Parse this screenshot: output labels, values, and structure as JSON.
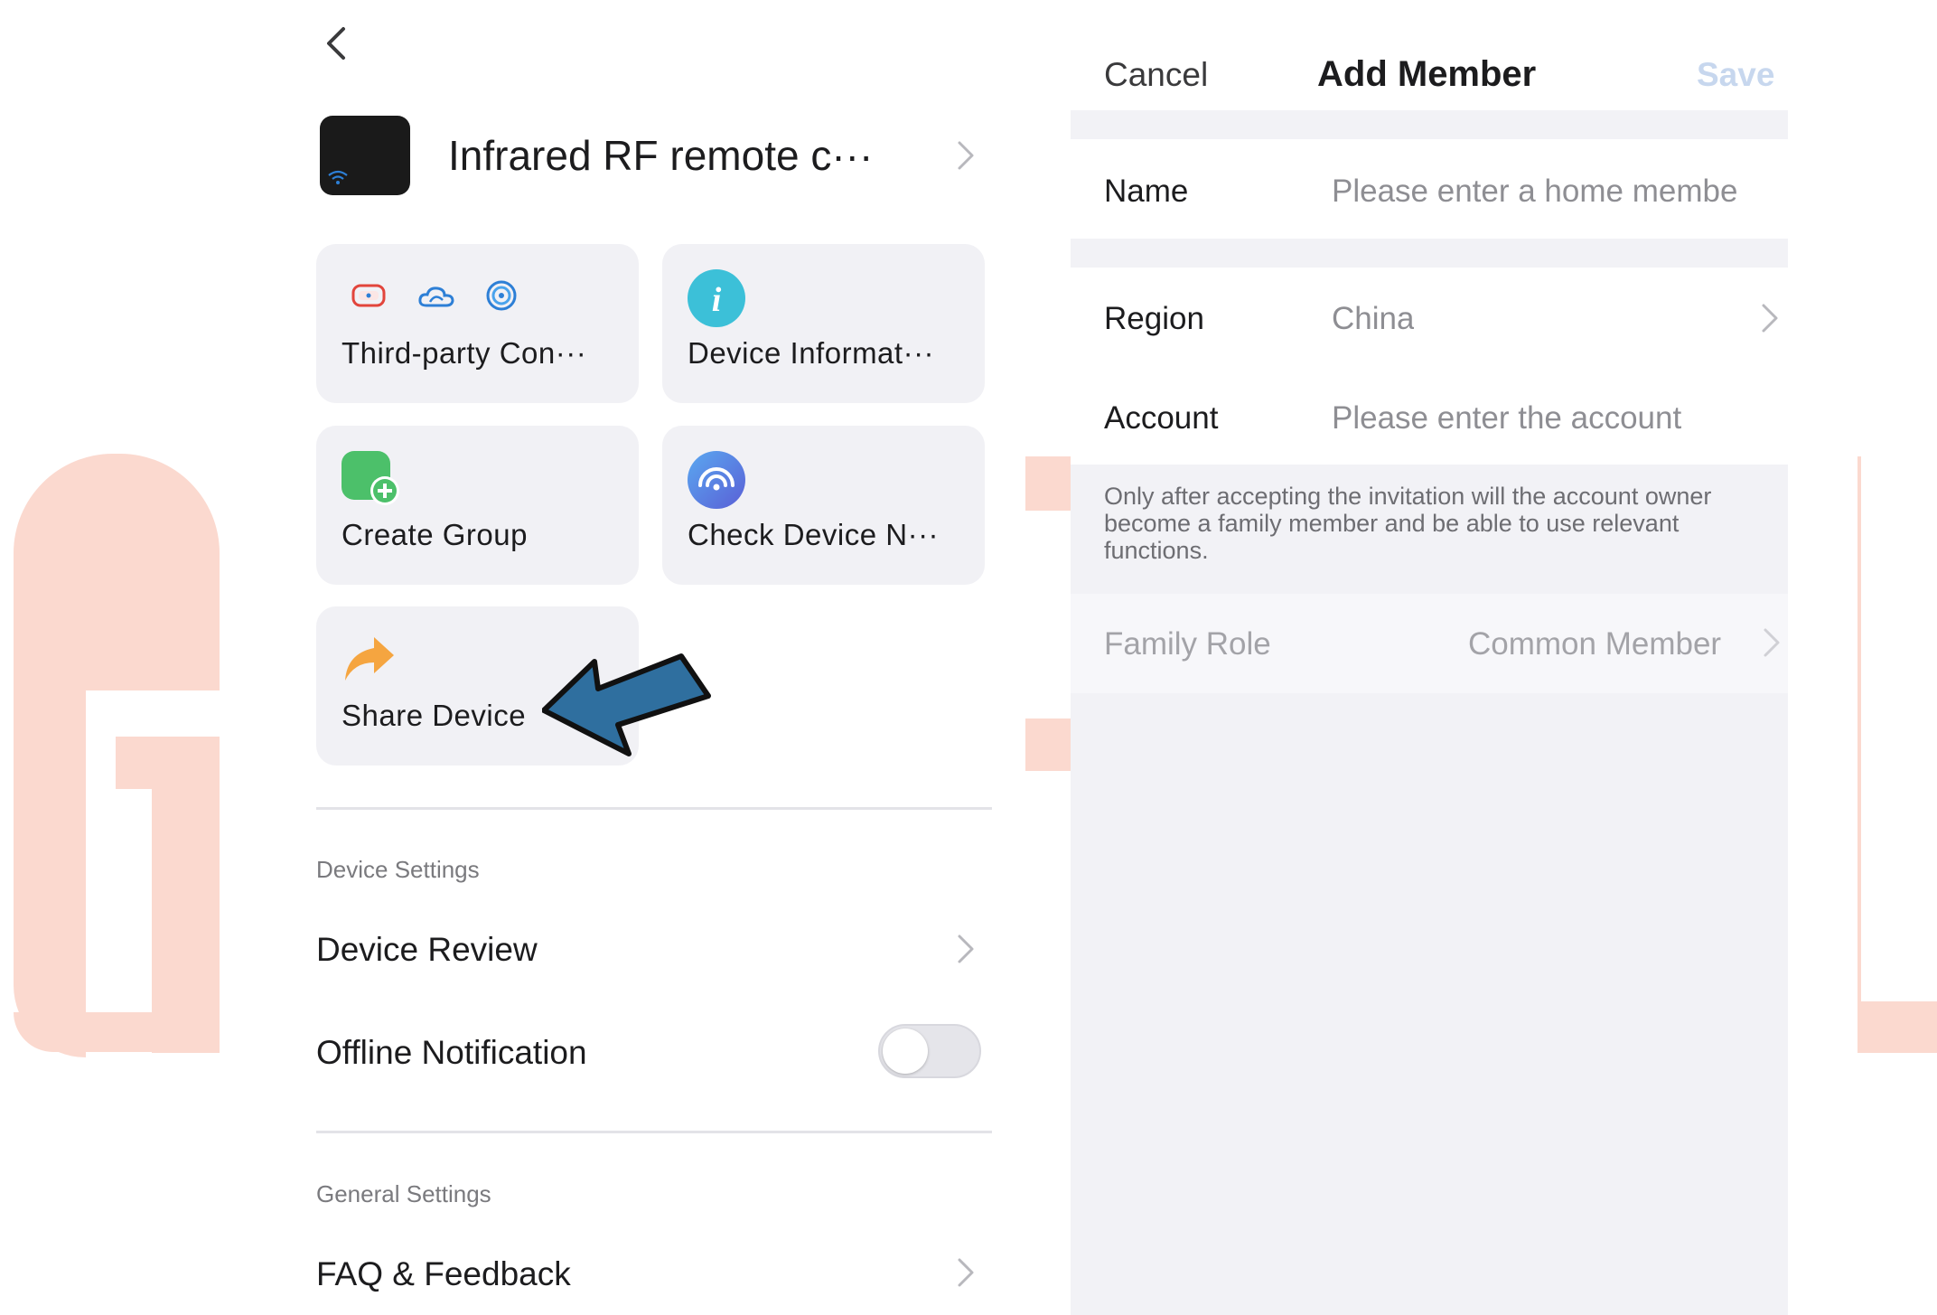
{
  "device": {
    "name": "Infrared RF remote c···"
  },
  "cards": {
    "third_party": "Third-party Con···",
    "device_info": "Device Informat···",
    "create_group": "Create Group",
    "check_network": "Check Device N···",
    "share_device": "Share Device"
  },
  "sections": {
    "device_settings": {
      "title": "Device Settings",
      "device_review": "Device Review",
      "offline_notification": "Offline Notification",
      "offline_notification_on": false
    },
    "general_settings": {
      "title": "General Settings",
      "faq": "FAQ & Feedback"
    }
  },
  "add_member": {
    "cancel": "Cancel",
    "title": "Add Member",
    "save": "Save",
    "name_label": "Name",
    "name_placeholder": "Please enter a home membe",
    "region_label": "Region",
    "region_value": "China",
    "account_label": "Account",
    "account_placeholder": "Please enter the account",
    "note": "Only after accepting the invitation will the account owner become a family member and be able to use relevant functions.",
    "role_label": "Family Role",
    "role_value": "Common Member"
  },
  "colors": {
    "accent_blue": "#4a90e2",
    "save_disabled": "#c7d7ee",
    "card_bg": "#f1f1f5",
    "watermark": "#fbd9cf",
    "share_icon": "#f5a540",
    "group_icon": "#4cc06a",
    "info_icon": "#3cc0d8",
    "arrow": "#2f6f9f"
  },
  "icons": [
    "back-arrow-icon",
    "chevron-right-icon",
    "wifi-icon",
    "alexa-icon",
    "cloud-icon",
    "siri-icon",
    "info-icon",
    "group-add-icon",
    "network-check-icon",
    "share-arrow-icon"
  ]
}
